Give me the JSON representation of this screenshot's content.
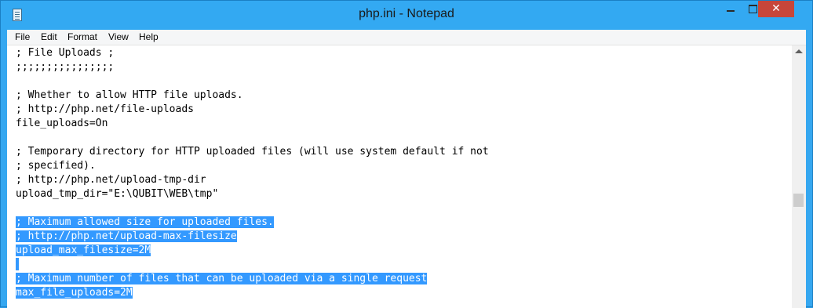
{
  "window": {
    "title": "php.ini - Notepad",
    "close_glyph": "✕"
  },
  "menu": {
    "items": [
      "File",
      "Edit",
      "Format",
      "View",
      "Help"
    ]
  },
  "editor": {
    "lines": [
      {
        "text": "; File Uploads ;",
        "selected": false
      },
      {
        "text": ";;;;;;;;;;;;;;;;",
        "selected": false
      },
      {
        "text": "",
        "selected": false
      },
      {
        "text": "; Whether to allow HTTP file uploads.",
        "selected": false
      },
      {
        "text": "; http://php.net/file-uploads",
        "selected": false
      },
      {
        "text": "file_uploads=On",
        "selected": false
      },
      {
        "text": "",
        "selected": false
      },
      {
        "text": "; Temporary directory for HTTP uploaded files (will use system default if not",
        "selected": false
      },
      {
        "text": "; specified).",
        "selected": false
      },
      {
        "text": "; http://php.net/upload-tmp-dir",
        "selected": false
      },
      {
        "text": "upload_tmp_dir=\"E:\\QUBIT\\WEB\\tmp\"",
        "selected": false
      },
      {
        "text": "",
        "selected": false
      },
      {
        "text": "; Maximum allowed size for uploaded files.",
        "selected": true
      },
      {
        "text": "; http://php.net/upload-max-filesize",
        "selected": true
      },
      {
        "text": "upload_max_filesize=2M",
        "selected": true
      },
      {
        "text": "",
        "selected": true
      },
      {
        "text": "; Maximum number of files that can be uploaded via a single request",
        "selected": true
      },
      {
        "text": "max_file_uploads=2M",
        "selected": true
      }
    ]
  },
  "colors": {
    "titlebar": "#33a9f2",
    "selection": "#3399ff",
    "close_button": "#c7463a"
  }
}
